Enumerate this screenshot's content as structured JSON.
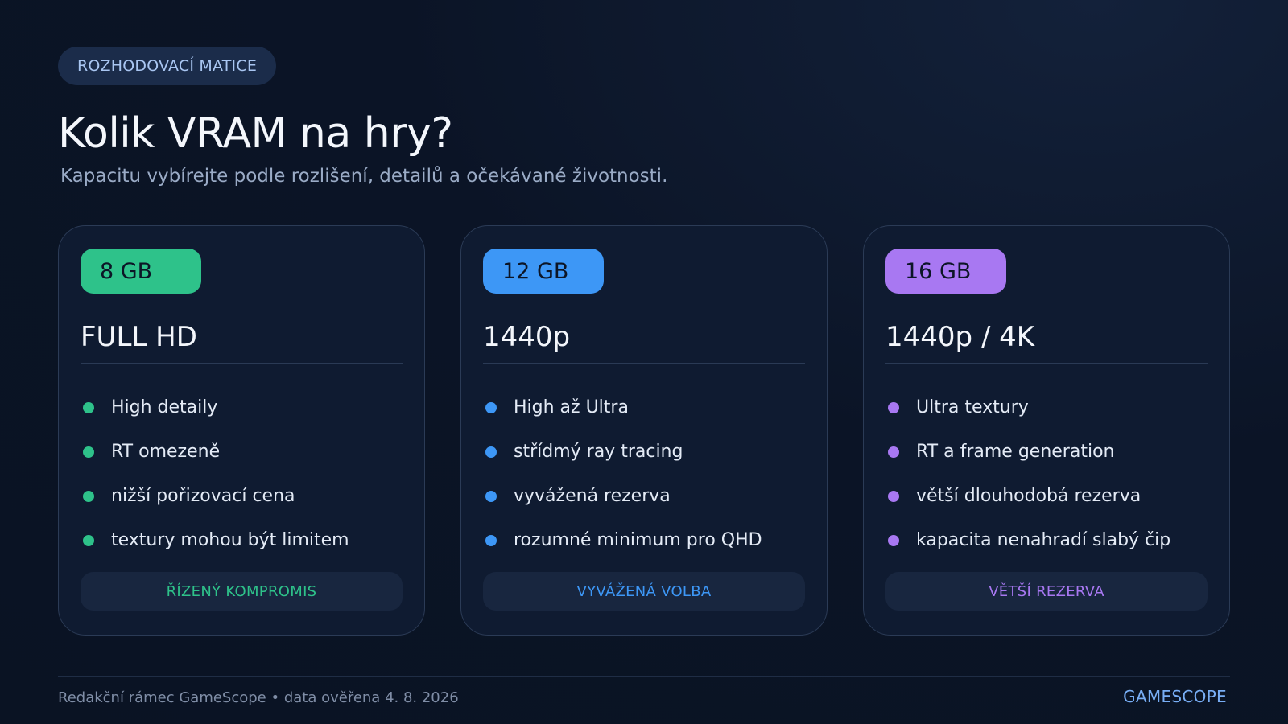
{
  "header": {
    "eyebrow": "ROZHODOVACÍ MATICE",
    "title": "Kolik VRAM na hry?",
    "subtitle": "Kapacitu vybírejte podle rozlišení, detailů a očekávané životnosti."
  },
  "colors": {
    "green": "#2ec28a",
    "blue": "#3d97f6",
    "purple": "#a878f2"
  },
  "cards": [
    {
      "chip": "8 GB",
      "heading": "FULL HD",
      "bullets": [
        "High detaily",
        "RT omezeně",
        "nižší pořizovací cena",
        "textury mohou být limitem"
      ],
      "verdict": "ŘÍZENÝ KOMPROMIS"
    },
    {
      "chip": "12 GB",
      "heading": "1440p",
      "bullets": [
        "High až Ultra",
        "střídmý ray tracing",
        "vyvážená rezerva",
        "rozumné minimum pro QHD"
      ],
      "verdict": "VYVÁŽENÁ VOLBA"
    },
    {
      "chip": "16 GB",
      "heading": "1440p / 4K",
      "bullets": [
        "Ultra textury",
        "RT a frame generation",
        "větší dlouhodobá rezerva",
        "kapacita nenahradí slabý čip"
      ],
      "verdict": "VĚTŠÍ REZERVA"
    }
  ],
  "footer": {
    "note": "Redakční rámec GameScope • data ověřena 4. 8. 2026",
    "brand": "GAMESCOPE"
  }
}
